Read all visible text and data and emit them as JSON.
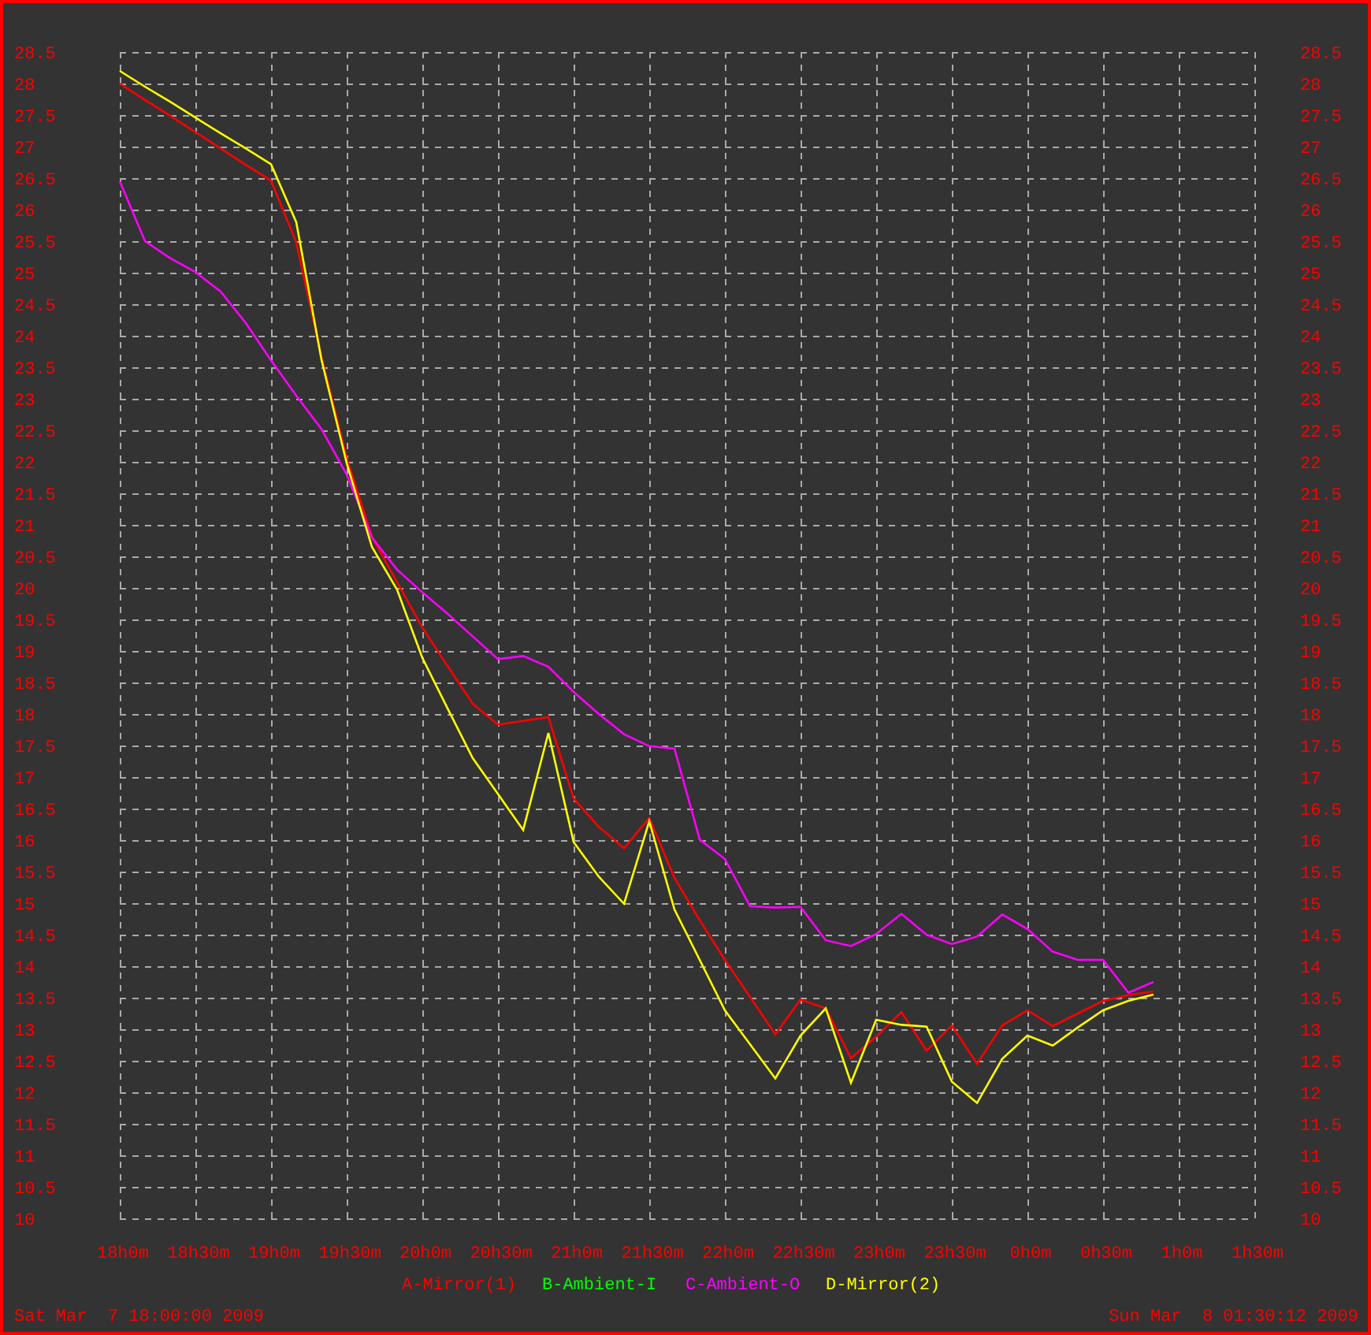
{
  "left_axis_labels": [
    "28.5",
    "28",
    "27.5",
    "27",
    "26.5",
    "26",
    "25.5",
    "25",
    "24.5",
    "24",
    "23.5",
    "23",
    "22.5",
    "22",
    "21.5",
    "21",
    "20.5",
    "20",
    "19.5",
    "19",
    "18.5",
    "18",
    "17.5",
    "17",
    "16.5",
    "16",
    "15.5",
    "15",
    "14.5",
    "14",
    "13.5",
    "13",
    "12.5",
    "12",
    "11.5",
    "11",
    "10.5",
    "10"
  ],
  "chart_data": {
    "type": "line",
    "grid": true,
    "categories": [
      "18h0m",
      null,
      null,
      "18h30m",
      null,
      null,
      "19h0m",
      null,
      null,
      "19h30m",
      null,
      null,
      "20h0m",
      null,
      null,
      "20h30m",
      null,
      null,
      "21h0m",
      null,
      null,
      "21h30m",
      null,
      null,
      "22h0m",
      null,
      null,
      "22h30m",
      null,
      null,
      "23h0m",
      null,
      null,
      "23h30m",
      null,
      null,
      "0h0m",
      null,
      null,
      "0h30m",
      null,
      null,
      "1h0m",
      null,
      null,
      "1h30m"
    ],
    "ylim": [
      10,
      28.5
    ],
    "yticks": [
      10,
      10.5,
      11,
      11.5,
      12,
      12.5,
      13,
      13.5,
      14,
      14.5,
      15,
      15.5,
      16,
      16.5,
      17,
      17.5,
      18,
      18.5,
      19,
      19.5,
      20,
      20.5,
      21,
      21.5,
      22,
      22.5,
      23,
      23.5,
      24,
      24.5,
      25,
      25.5,
      26,
      26.5,
      27,
      27.5,
      28,
      28.5
    ],
    "series": [
      {
        "name": "A-Mirror(1)",
        "color": "#ff0000",
        "values": [
          28.0,
          27.74,
          27.49,
          27.23,
          26.97,
          26.71,
          26.46,
          25.48,
          23.66,
          22.06,
          20.81,
          20.09,
          19.37,
          18.76,
          18.16,
          17.83,
          17.89,
          17.95,
          16.66,
          16.21,
          15.87,
          16.35,
          15.4,
          14.73,
          14.1,
          13.51,
          12.92,
          13.47,
          13.33,
          12.54,
          12.88,
          13.27,
          12.66,
          13.06,
          12.45,
          13.06,
          13.3,
          13.05,
          13.25,
          13.45,
          13.54,
          13.6,
          null,
          null,
          null,
          null
        ]
      },
      {
        "name": "B-Ambient-I",
        "color": "#00ff00",
        "values": [
          null,
          null,
          null,
          null,
          null,
          null,
          null,
          null,
          null,
          null,
          null,
          null,
          null,
          null,
          null,
          null,
          null,
          null,
          null,
          null,
          null,
          null,
          null,
          null,
          null,
          null,
          null,
          null,
          null,
          null,
          null,
          null,
          null,
          null,
          null,
          null,
          null,
          null,
          null,
          null,
          null,
          null,
          null,
          null,
          null,
          null
        ]
      },
      {
        "name": "C-Ambient-O",
        "color": "#ff00ff",
        "values": [
          26.45,
          25.5,
          25.23,
          25.01,
          24.7,
          24.2,
          23.61,
          23.05,
          22.52,
          21.8,
          20.8,
          20.29,
          19.93,
          19.59,
          19.23,
          18.87,
          18.92,
          18.75,
          18.35,
          18.0,
          17.68,
          17.49,
          17.45,
          16.01,
          15.7,
          14.95,
          14.93,
          14.94,
          14.41,
          14.32,
          14.51,
          14.83,
          14.5,
          14.35,
          14.47,
          14.82,
          14.59,
          14.23,
          14.1,
          14.1,
          13.58,
          13.75,
          null,
          null,
          null,
          null
        ]
      },
      {
        "name": "D-Mirror(2)",
        "color": "#ffff00",
        "values": [
          28.2,
          27.95,
          27.71,
          27.46,
          27.21,
          26.97,
          26.72,
          25.8,
          23.62,
          21.98,
          20.65,
          19.97,
          18.89,
          18.09,
          17.3,
          16.73,
          16.16,
          17.7,
          15.97,
          15.42,
          14.99,
          16.3,
          14.9,
          14.1,
          13.3,
          12.76,
          12.22,
          12.9,
          13.33,
          12.15,
          13.15,
          13.07,
          13.04,
          12.17,
          11.83,
          12.53,
          12.9,
          12.74,
          13.03,
          13.3,
          13.45,
          13.55,
          null,
          null,
          null,
          null
        ]
      }
    ]
  },
  "start_time": "Sat Mar  7 18:00:00 2009",
  "end_time": "Sun Mar  8 01:30:12 2009"
}
